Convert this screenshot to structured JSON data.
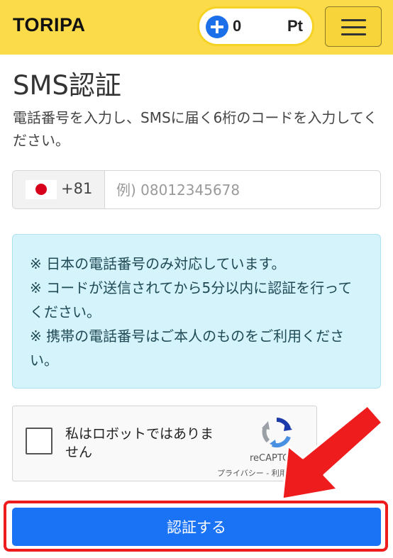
{
  "header": {
    "logo": "TORIPA",
    "points": {
      "value": "0",
      "unit": "Pt"
    },
    "menu_icon": "hamburger-icon",
    "background": "#fbdb4a"
  },
  "page": {
    "title": "SMS認証",
    "instruction": "電話番号を入力し、SMSに届く6桁のコードを入力してください。"
  },
  "phone": {
    "flag_icon": "japan-flag-icon",
    "dial_code": "+81",
    "placeholder": "例) 08012345678",
    "value": ""
  },
  "notice": {
    "lines": [
      "※ 日本の電話番号のみ対応しています。",
      "※ コードが送信されてから5分以内に認証を行ってください。",
      "※ 携帯の電話番号はご本人のものをご利用ください。"
    ],
    "background": "#d4f3fa"
  },
  "captcha": {
    "label": "私はロボットではありません",
    "brand": "reCAPTCHA",
    "links": "プライバシー - 利用規約",
    "checked": false
  },
  "submit": {
    "label": "認証する",
    "color": "#1a73f5"
  },
  "annotation": {
    "color": "#ee1c1c"
  }
}
